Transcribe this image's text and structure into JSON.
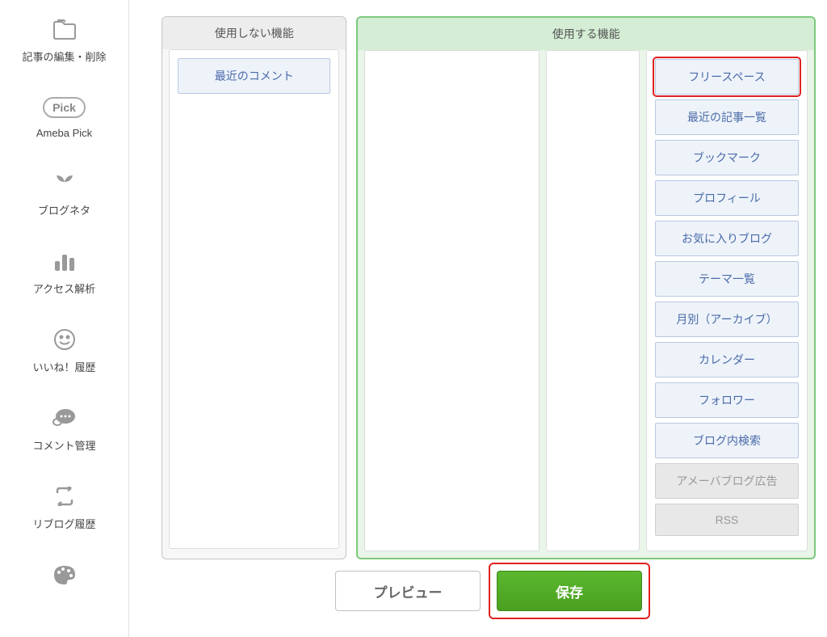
{
  "sidebar": {
    "items": [
      {
        "label": "記事の編集・削除",
        "icon": "folder"
      },
      {
        "label": "Ameba Pick",
        "icon": "pick"
      },
      {
        "label": "ブログネタ",
        "icon": "sprout"
      },
      {
        "label": "アクセス解析",
        "icon": "bars"
      },
      {
        "label": "いいね！履歴",
        "icon": "smile"
      },
      {
        "label": "コメント管理",
        "icon": "comment"
      },
      {
        "label": "リブログ履歴",
        "icon": "cycle"
      },
      {
        "label": "",
        "icon": "palette"
      }
    ]
  },
  "panels": {
    "unused_header": "使用しない機能",
    "used_header": "使用する機能",
    "unused_items": [
      {
        "label": "最近のコメント"
      }
    ],
    "used_items": [
      {
        "label": "フリースペース",
        "highlighted": true
      },
      {
        "label": "最近の記事一覧"
      },
      {
        "label": "ブックマーク"
      },
      {
        "label": "プロフィール"
      },
      {
        "label": "お気に入りブログ"
      },
      {
        "label": "テーマ一覧"
      },
      {
        "label": "月別（アーカイブ）"
      },
      {
        "label": "カレンダー"
      },
      {
        "label": "フォロワー"
      },
      {
        "label": "ブログ内検索"
      },
      {
        "label": "アメーバブログ広告",
        "disabled": true
      },
      {
        "label": "RSS",
        "disabled": true
      }
    ]
  },
  "buttons": {
    "preview": "プレビュー",
    "save": "保存"
  },
  "pick_text": "Pick"
}
